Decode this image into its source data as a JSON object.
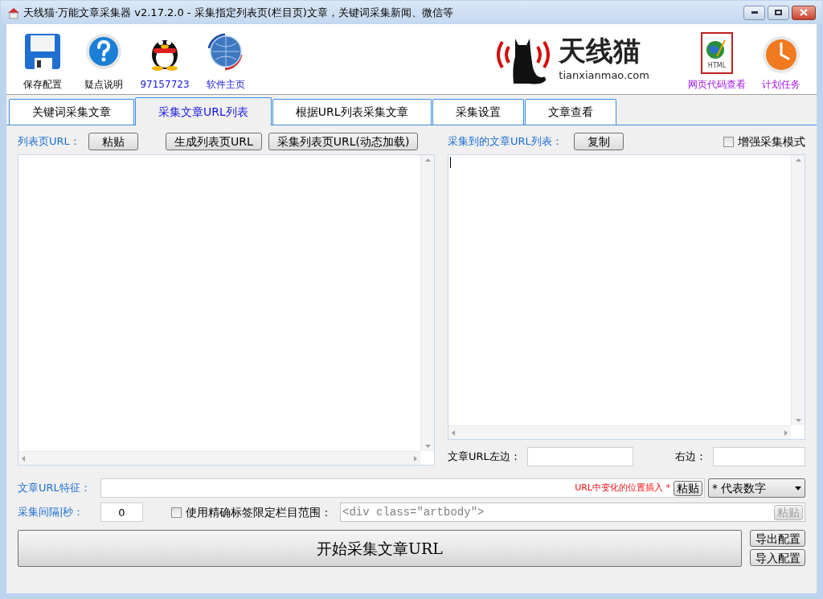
{
  "window": {
    "title": "天线猫·万能文章采集器 v2.17.2.0 - 采集指定列表页(栏目页)文章，关键词采集新闻、微信等"
  },
  "toolbar": {
    "left": [
      {
        "kind": "save",
        "label": "保存配置",
        "link": false
      },
      {
        "kind": "help",
        "label": "疑点说明",
        "link": false
      },
      {
        "kind": "qq",
        "label": "97157723",
        "link": true
      },
      {
        "kind": "globe",
        "label": "软件主页",
        "link": true
      }
    ],
    "logo": {
      "name": "天线猫",
      "domain": "tianxianmao.com"
    },
    "right": [
      {
        "kind": "html",
        "label": "网页代码查看",
        "icon_text": "HTML"
      },
      {
        "kind": "clock",
        "label": "计划任务"
      }
    ]
  },
  "tabs": [
    {
      "label": "关键词采集文章",
      "selected": false
    },
    {
      "label": "采集文章URL列表",
      "selected": true
    },
    {
      "label": "根据URL列表采集文章",
      "selected": false
    },
    {
      "label": "采集设置",
      "selected": false
    },
    {
      "label": "文章查看",
      "selected": false
    }
  ],
  "left_panel": {
    "label": "列表页URL：",
    "buttons": [
      "粘贴",
      "生成列表页URL",
      "采集列表页URL(动态加载)"
    ]
  },
  "right_panel": {
    "label": "采集到的文章URL列表：",
    "copy_button": "复制",
    "enhanced_mode": {
      "label": "增强采集模式",
      "checked": false
    },
    "left_label": "文章URL左边：",
    "right_label": "右边："
  },
  "url_pattern": {
    "label": "文章URL特征：",
    "hint": "URL中变化的位置插入 *",
    "paste_button": "粘贴",
    "select_value": "* 代表数字"
  },
  "interval": {
    "label": "采集间隔|秒：",
    "value": "0",
    "precise_tag": {
      "label": "使用精确标签限定栏目范围：",
      "checked": false
    },
    "tag_placeholder": "<div class=\"artbody\">",
    "paste_button": "粘贴",
    "paste_disabled": true
  },
  "start_button": "开始采集文章URL",
  "side_buttons": [
    "导出配置",
    "导入配置"
  ]
}
